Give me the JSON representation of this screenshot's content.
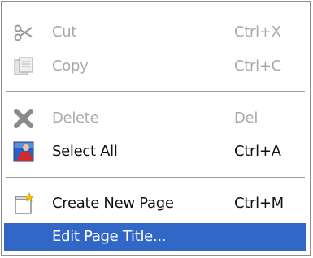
{
  "colors": {
    "highlight": "#3168c8",
    "disabled_text": "#a9a9a9",
    "separator": "#9c9c9c"
  },
  "menu": {
    "items": [
      {
        "label": "Cut",
        "shortcut": "Ctrl+X",
        "icon": "scissors-icon",
        "enabled": false
      },
      {
        "label": "Copy",
        "shortcut": "Ctrl+C",
        "icon": "copy-icon",
        "enabled": false
      },
      {
        "label": "Delete",
        "shortcut": "Del",
        "icon": "delete-icon",
        "enabled": false
      },
      {
        "label": "Select All",
        "shortcut": "Ctrl+A",
        "icon": "select-all-icon",
        "enabled": true
      },
      {
        "label": "Create New Page",
        "shortcut": "Ctrl+M",
        "icon": "new-page-icon",
        "enabled": true
      },
      {
        "label": "Edit Page Title...",
        "shortcut": "",
        "icon": "",
        "enabled": true,
        "highlighted": true
      }
    ]
  }
}
